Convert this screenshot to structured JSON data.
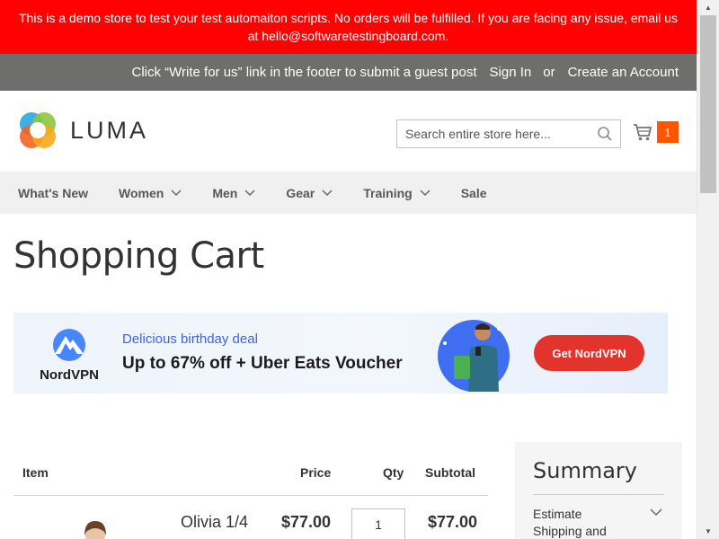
{
  "notice": {
    "text": "This is a demo store to test your test automaiton scripts. No orders will be fulfilled. If you are facing any issue, email us at hello@softwaretestingboard.com."
  },
  "topbar": {
    "write_for_us": "Click “Write for us” link in the footer to submit a guest post",
    "sign_in": "Sign In",
    "or": "or",
    "create_account": "Create an Account"
  },
  "header": {
    "logo_text": "LUMA",
    "search_placeholder": "Search entire store here...",
    "cart_count": "1"
  },
  "nav": {
    "items": [
      {
        "label": "What's New",
        "has_dropdown": false
      },
      {
        "label": "Women",
        "has_dropdown": true
      },
      {
        "label": "Men",
        "has_dropdown": true
      },
      {
        "label": "Gear",
        "has_dropdown": true
      },
      {
        "label": "Training",
        "has_dropdown": true
      },
      {
        "label": "Sale",
        "has_dropdown": false
      }
    ]
  },
  "page_title": "Shopping Cart",
  "ad": {
    "brand": "NordVPN",
    "deal": "Delicious birthday deal",
    "offer": "Up to 67% off + Uber Eats Voucher",
    "cta": "Get NordVPN"
  },
  "cart_table": {
    "headers": {
      "item": "Item",
      "price": "Price",
      "qty": "Qty",
      "subtotal": "Subtotal"
    },
    "rows": [
      {
        "name": "Olivia 1/4",
        "price": "$77.00",
        "qty": "1",
        "subtotal": "$77.00"
      }
    ]
  },
  "summary": {
    "title": "Summary",
    "estimate": "Estimate Shipping and"
  },
  "colors": {
    "notice_bg": "#ff0101",
    "topbar_bg": "#6e6e6d",
    "cart_badge": "#ff5501",
    "ad_cta": "#e2342c"
  }
}
